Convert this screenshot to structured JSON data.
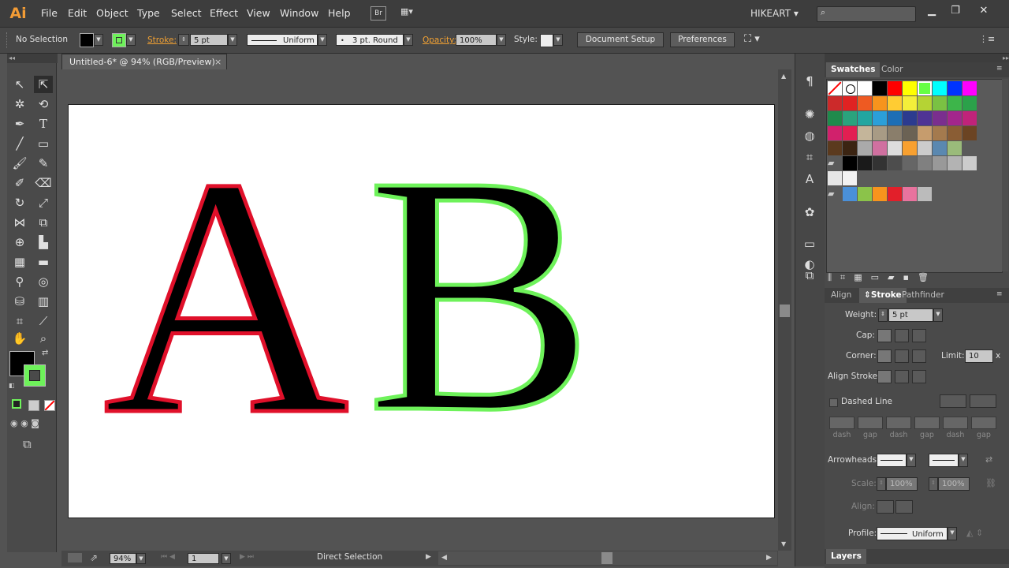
{
  "app": {
    "logo": "Ai",
    "bridge": "Br",
    "workspace": "HIKEART"
  },
  "menu": [
    "File",
    "Edit",
    "Object",
    "Type",
    "Select",
    "Effect",
    "View",
    "Window",
    "Help"
  ],
  "control": {
    "selection": "No Selection",
    "stroke_label": "Stroke:",
    "stroke_weight": "5 pt",
    "uniform": "Uniform",
    "brush": "3 pt. Round",
    "opacity_label": "Opacity:",
    "opacity": "100%",
    "style_label": "Style:",
    "doc_setup": "Document Setup",
    "preferences": "Preferences"
  },
  "document": {
    "tab": "Untitled-6* @ 94% (RGB/Preview)",
    "letters": [
      {
        "char": "A",
        "stroke": "#e0102a"
      },
      {
        "char": "B",
        "stroke": "#6ef25a"
      }
    ]
  },
  "status": {
    "zoom": "94%",
    "page": "1",
    "tool": "Direct Selection"
  },
  "swatches_panel": {
    "tabs": [
      "Swatches",
      "Color"
    ],
    "rows": [
      [
        "#ffffff",
        "#ffffff",
        "#ffffff",
        "#000000",
        "#ff0000",
        "#ffff00",
        "#66ff44",
        "#00ffff",
        "#0033ff",
        "#ff00ff"
      ],
      [
        "#cc2a2a",
        "#e02222",
        "#ee5a22",
        "#f7941d",
        "#ffcc33",
        "#f4ef3a",
        "#b5d334",
        "#7ac143",
        "#3db54a",
        "#2ba14a"
      ],
      [
        "#1f8a4c",
        "#2aa37d",
        "#22a6a0",
        "#2b9fd9",
        "#1d6eb5",
        "#2c3b8f",
        "#4f3395",
        "#7a2e8e",
        "#a3268c",
        "#c0237a"
      ],
      [
        "#d1216c",
        "#e21f52",
        "#c4b59a",
        "#a89b85",
        "#8a7e6b",
        "#6b6254",
        "#c69c6d",
        "#a47a4e",
        "#8a5d34",
        "#6b4423"
      ],
      [
        "#5b3a1e",
        "#3b2412",
        "#aaaaaa",
        "#d070a0",
        "#dddddd",
        "#f7a030",
        "#cccccc",
        "#5a88b0",
        "#9abb7a"
      ]
    ],
    "grays": [
      "#000000",
      "#1a1a1a",
      "#333333",
      "#4d4d4d",
      "#666666",
      "#808080",
      "#999999",
      "#b3b3b3",
      "#cccccc"
    ],
    "grays2": [
      "#e6e6e6",
      "#f2f2f2"
    ],
    "group3": [
      "#4a90d9",
      "#8bc34a",
      "#f7941d",
      "#e21f2a",
      "#e8739e",
      "#bbbbbb"
    ]
  },
  "stroke_panel": {
    "tabs": [
      "Align",
      "Stroke",
      "Pathfinder"
    ],
    "weight_label": "Weight:",
    "weight": "5 pt",
    "cap_label": "Cap:",
    "corner_label": "Corner:",
    "limit_label": "Limit:",
    "limit": "10",
    "limit_unit": "x",
    "align_label": "Align Stroke:",
    "dashed_label": "Dashed Line",
    "dash_labels": [
      "dash",
      "gap",
      "dash",
      "gap",
      "dash",
      "gap"
    ],
    "arrowheads_label": "Arrowheads:",
    "scale_label": "Scale:",
    "scale1": "100%",
    "scale2": "100%",
    "align2_label": "Align:",
    "profile_label": "Profile:",
    "profile": "Uniform"
  },
  "layers": {
    "title": "Layers"
  }
}
